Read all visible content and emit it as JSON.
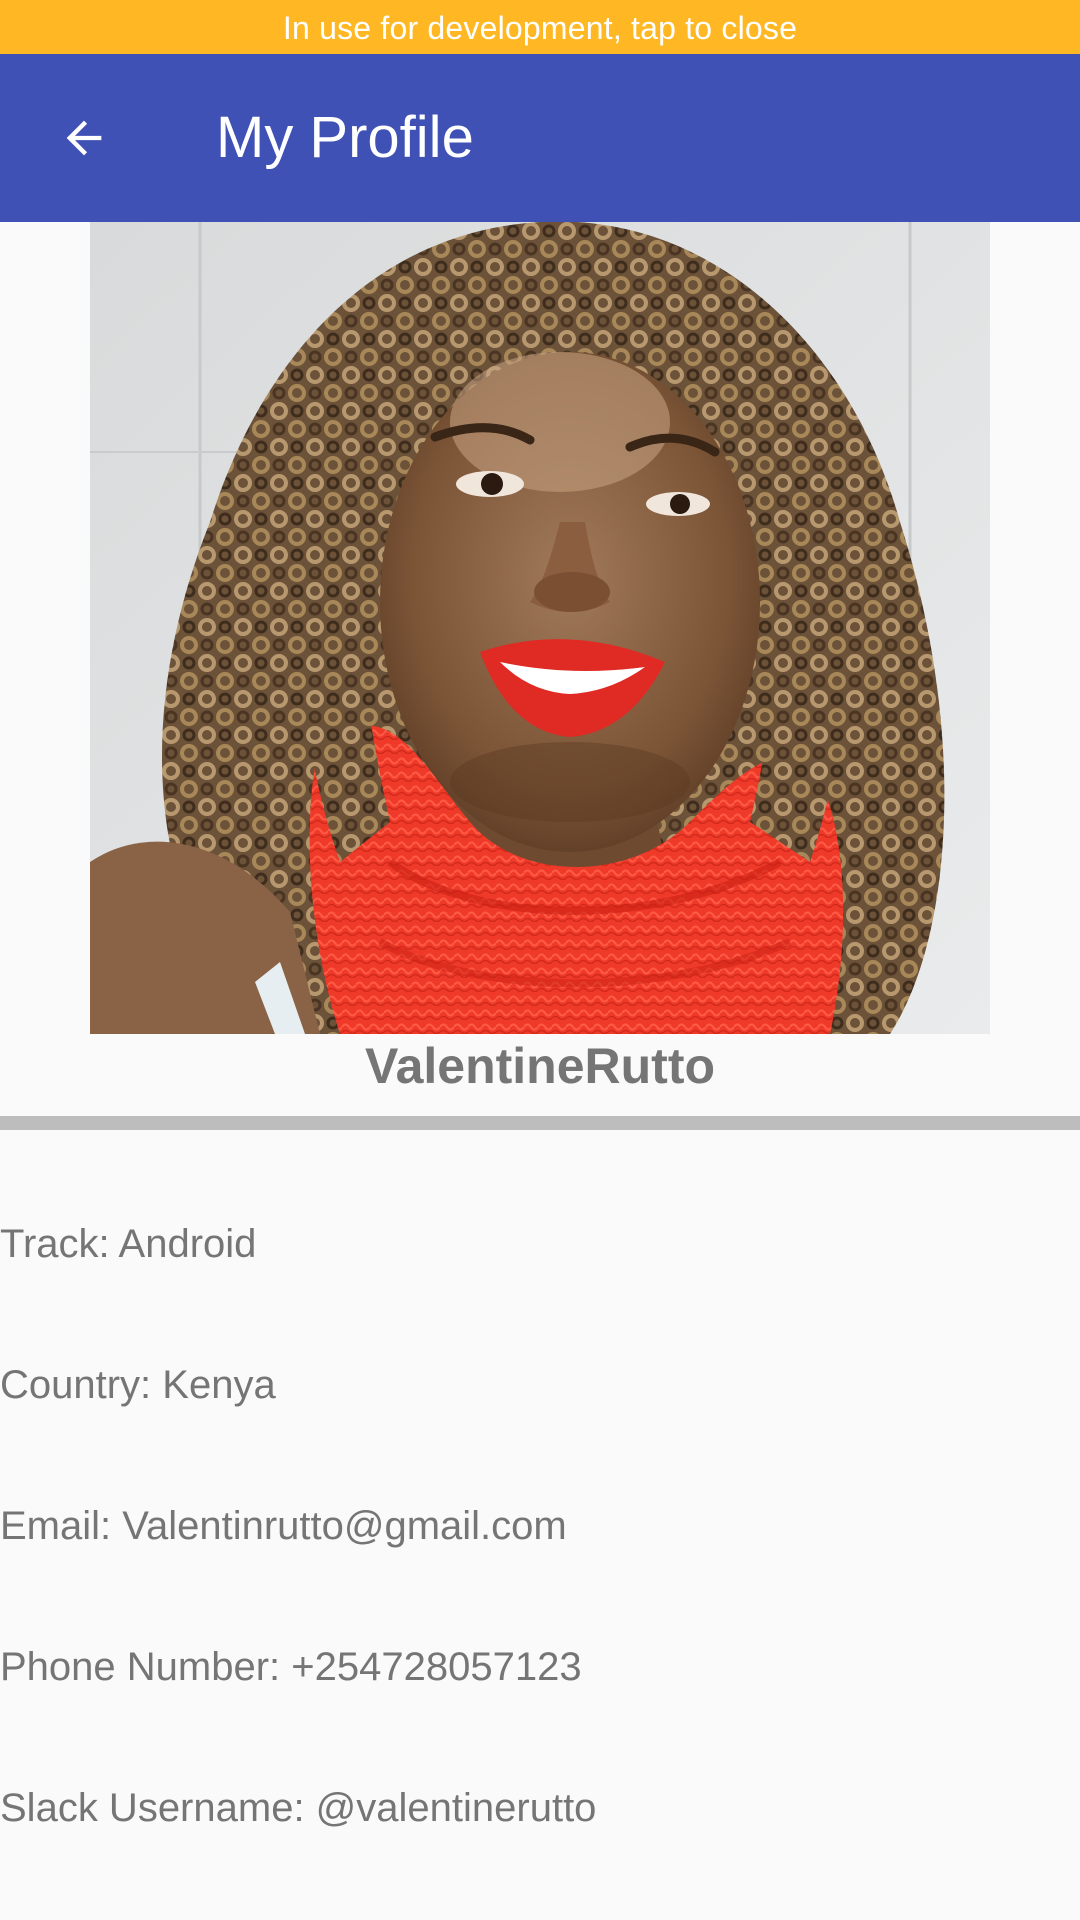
{
  "banner": {
    "text": "In use for development, tap to close",
    "color": "#FFB823"
  },
  "app_bar": {
    "title": "My Profile",
    "back_icon": "arrow-back-icon",
    "color": "#3F51B5"
  },
  "profile": {
    "name": "ValentineRutto",
    "details": [
      {
        "text": "Track: Android"
      },
      {
        "text": "Country: Kenya"
      },
      {
        "text": "Email: Valentinrutto@gmail.com"
      },
      {
        "text": "Phone Number: +254728057123"
      },
      {
        "text": "Slack Username: @valentinerutto"
      }
    ]
  },
  "colors": {
    "text_secondary": "#757575",
    "divider": "#BDBDBD",
    "background": "#FAFAFA"
  }
}
